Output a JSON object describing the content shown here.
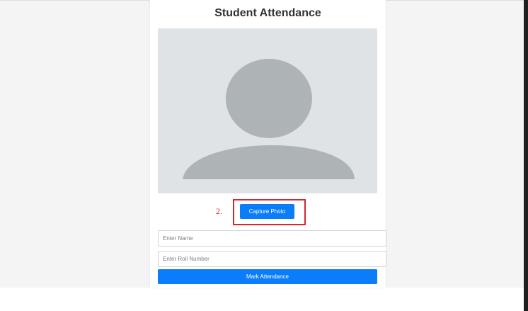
{
  "app": {
    "title": "Student Attendance"
  },
  "photo": {
    "placeholder_icon": "person-silhouette-icon",
    "background_color": "#dfe3e5",
    "silhouette_color": "#aeb4b6"
  },
  "annotation": {
    "step_label": "2.",
    "color": "#d9262d"
  },
  "actions": {
    "capture_label": "Capture Photo",
    "mark_label": "Mark Attendance",
    "accent_color": "#0b7dfa"
  },
  "form": {
    "name_placeholder": "Enter Name",
    "name_value": "",
    "roll_placeholder": "Enter Roll Number",
    "roll_value": ""
  }
}
